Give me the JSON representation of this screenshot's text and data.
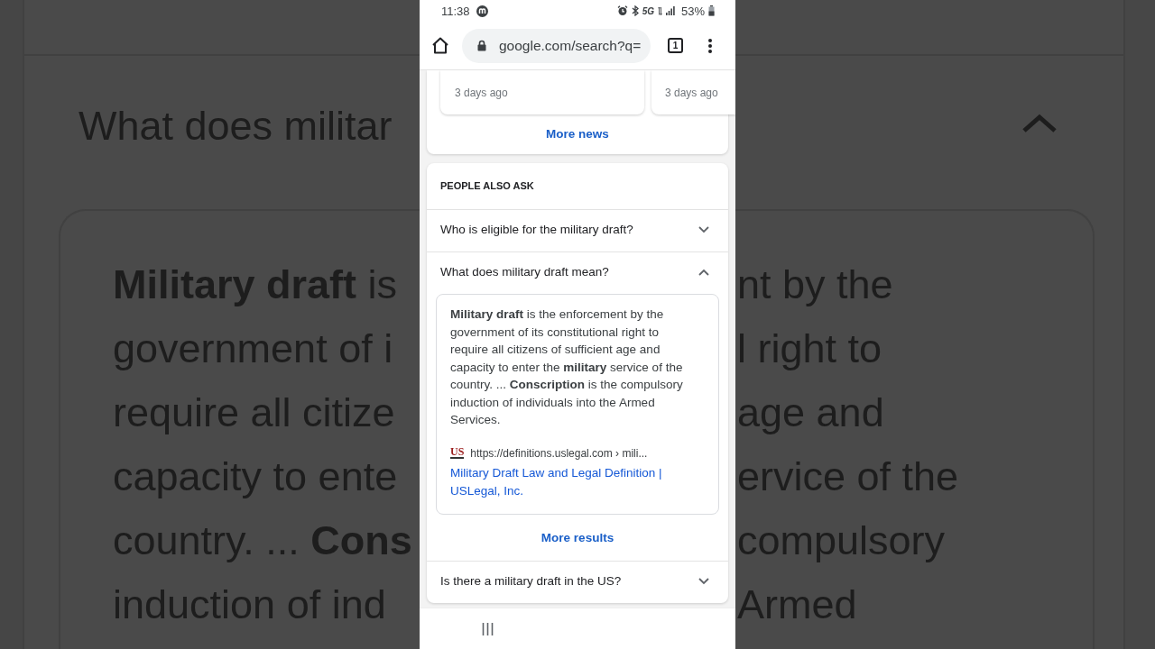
{
  "backdrop": {
    "question": "What does militar",
    "left_lines": [
      "**Military draft** is",
      "government of i",
      "require all citize",
      "capacity to ente",
      "country. ... **Cons**",
      "induction of ind"
    ],
    "right_lines": [
      "nt by the",
      "l right to",
      "age and",
      "ervice of the",
      "compulsory",
      "Armed"
    ]
  },
  "status_bar": {
    "time": "11:38",
    "network": "5G",
    "battery": "53%"
  },
  "address_bar": {
    "url": "google.com/search?q=",
    "tab_count": "1"
  },
  "news": {
    "cards": [
      {
        "time": "3 days ago"
      },
      {
        "time": "3 days ago"
      }
    ],
    "more_link": "More news"
  },
  "people_also_ask": {
    "heading": "PEOPLE ALSO ASK",
    "questions": [
      {
        "text": "Who is eligible for the military draft?",
        "expanded": false
      },
      {
        "text": "What does military draft mean?",
        "expanded": true,
        "answer": "**Military draft** is the enforcement by the government of its constitutional right to require all citizens of sufficient age and capacity to enter the **military** service of the country. ... **Conscription** is the compulsory induction of individuals into the Armed Services.",
        "source_logo": "US",
        "source_url": "https://definitions.uslegal.com › mili...",
        "source_title": "Military Draft Law and Legal Definition | USLegal, Inc.",
        "more_link": "More results"
      },
      {
        "text": "Is there a military draft in the US?",
        "expanded": false
      }
    ]
  }
}
